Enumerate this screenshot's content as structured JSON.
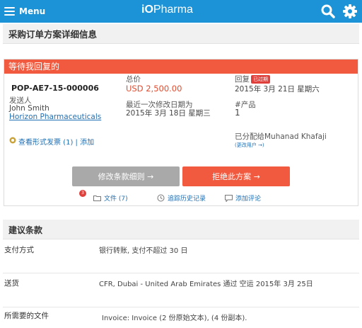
{
  "topbar": {
    "menu_label": "Menu",
    "logo_io": "iO",
    "logo_rest": "Pharma",
    "accent": "#1b93d6"
  },
  "page_title": "采购订单方案详细信息",
  "card": {
    "header": "等待我回复的",
    "po_number": "POP-AE7-15-000006",
    "sender_label": "发送人",
    "sender_name": "John Smith",
    "sender_company": "Horizon Pharmaceuticals",
    "total_label": "总价",
    "total_value": "USD 2,500.00",
    "modified_label": "最近一次修改日期为",
    "modified_value": "2015年 3月 18日 星期三",
    "reply_label": "回复",
    "overdue_badge": "已过期",
    "reply_value": "2015年 3月 21日 星期六",
    "products_label": "#产品",
    "products_value": "1",
    "assigned_text": "已分配给Muhanad Khafaji",
    "change_user": "(更改用户 →)",
    "invoice_link": "查看形式发票 (1)",
    "separator": "|",
    "add_link": "添加",
    "btn_modify": "修改条款细则 →",
    "btn_reject": "拒绝此方案 →",
    "files_badge": "3",
    "files_link": "文件 (7)",
    "history_link": "追踪历史记录",
    "comment_link": "添加评论",
    "header_color": "#f15a3f"
  },
  "terms_title": "建议条款",
  "terms": [
    {
      "label": "支付方式",
      "value": "银行转账, 支付不超过 30 日"
    },
    {
      "label": "送货",
      "value": "CFR, Dubai - United Arab Emirates 通过 空运 2015年 3月 25日"
    },
    {
      "label": "所需要的文件",
      "value": "Invoice: Invoice (2 份原始文本), (4 份副本)."
    }
  ]
}
